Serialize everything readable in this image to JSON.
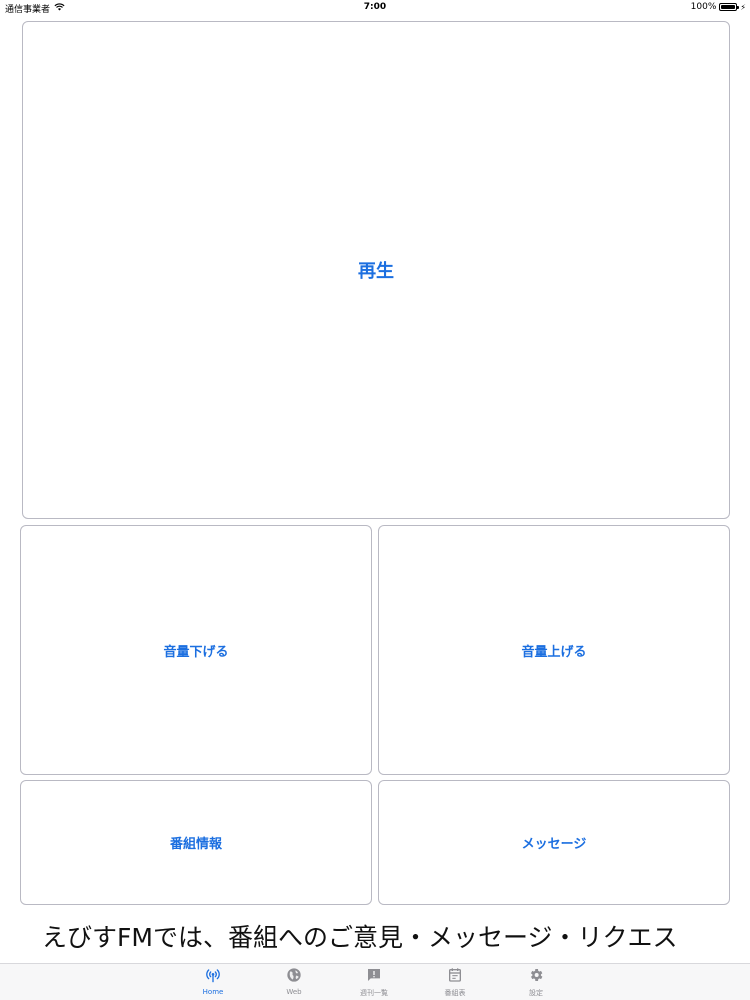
{
  "status_bar": {
    "carrier": "通信事業者",
    "time": "7:00",
    "battery_text": "100%",
    "battery_level": 1.0
  },
  "controls": {
    "play_label": "再生",
    "volume_down_label": "音量下げる",
    "volume_up_label": "音量上げる",
    "program_info_label": "番組情報",
    "message_label": "メッセージ"
  },
  "ticker": {
    "text": "えびすFMでは、番組へのご意見・メッセージ・リクエス"
  },
  "tab_bar": {
    "tabs": [
      {
        "label": "Home",
        "icon": "radio-antenna-icon",
        "active": true
      },
      {
        "label": "Web",
        "icon": "globe-icon",
        "active": false
      },
      {
        "label": "週刊一覧",
        "icon": "feedback-icon",
        "active": false
      },
      {
        "label": "番組表",
        "icon": "calendar-icon",
        "active": false
      },
      {
        "label": "設定",
        "icon": "gear-icon",
        "active": false
      }
    ]
  },
  "colors": {
    "accent": "#1c6fe0",
    "tab_inactive": "#8e8e93",
    "border": "#b9b9c3"
  }
}
